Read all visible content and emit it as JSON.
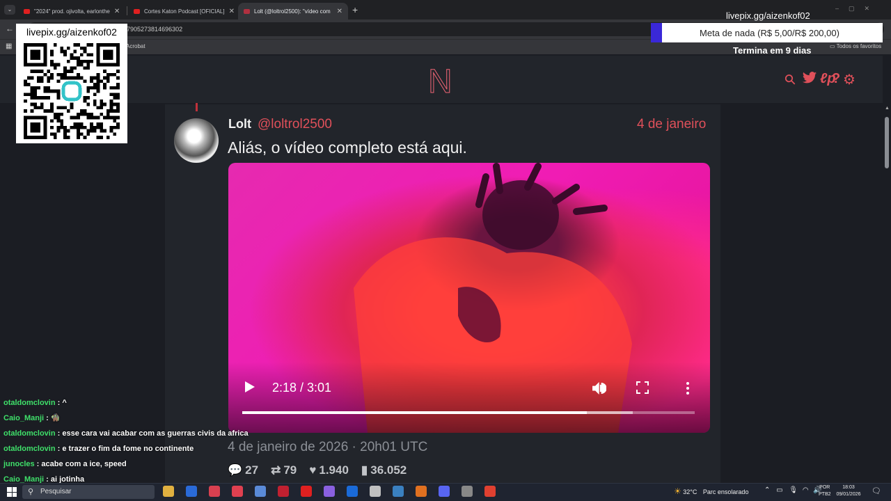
{
  "browser": {
    "tabs": [
      {
        "title": "\"2024\" prod. ojivolta, earlonthe",
        "favicon_color": "#e02020"
      },
      {
        "title": "Cortes Katon Podcast [OFICIAL]",
        "favicon_color": "#e02020"
      },
      {
        "title": "Lolt (@loltrol2500): \"vídeo com",
        "favicon_color": "#b03040"
      }
    ],
    "new_tab": "+",
    "url_fragment": "s/2007905273814696302",
    "bookmark_acrobat": "Acrobat",
    "bookmark_all": "Todos os favoritos"
  },
  "site": {
    "logo": "N",
    "accent": "#e0505a",
    "icons": [
      "search-icon",
      "twitter-icon",
      "lp-icon",
      "help-icon",
      "gear-icon"
    ],
    "icon_glyphs": {
      "search": "⚲",
      "twitter": "🐦",
      "lp": "ℓp",
      "help": "?",
      "gear": "⚙"
    }
  },
  "post": {
    "author": "Lolt",
    "handle": "@loltrol2500",
    "date": "4 de janeiro",
    "text": "Aliás, o vídeo completo está aqui.",
    "timestamp": "4 de janeiro de 2026 · 20h01 UTC",
    "video": {
      "time": "2:18 / 3:01",
      "progress": 0.762,
      "buffered": 0.863
    },
    "stats": {
      "replies": "27",
      "reposts": "79",
      "likes": "1.940",
      "views": "36.052"
    }
  },
  "overlay": {
    "qr_label": "livepix.gg/aizenkof02",
    "top_label": "livepix.gg/aizenkof02",
    "goal_text": "Meta de nada (R$ 5,00/R$ 200,00)",
    "goal_progress": 0.025,
    "goal_color": "#3a28d8",
    "goal_sub": "Termina em 9 dias"
  },
  "chat": [
    {
      "user": "otaldomclovin",
      "message": "^"
    },
    {
      "user": "Caio_Manji",
      "message": "🧌"
    },
    {
      "user": "otaldomclovin",
      "message": "esse cara vai acabar com as guerras civis da africa"
    },
    {
      "user": "otaldomclovin",
      "message": "e trazer o fim da fome no continente"
    },
    {
      "user": "junocles",
      "message": "acabe com a ice, speed"
    },
    {
      "user": "Caio_Manji",
      "message": "ai jotinha"
    }
  ],
  "taskbar": {
    "search": "Pesquisar",
    "weather_temp": "32°C",
    "weather_desc": "Parc ensolarado",
    "lang_1": "POR",
    "lang_2": "PTB2",
    "time": "18:03",
    "date": "09/01/2026",
    "app_colors": [
      "#e0b040",
      "#2a6ad8",
      "#d84050",
      "#e04050",
      "#5a8ad8",
      "#c02030",
      "#e02020",
      "#8a60e0",
      "#1a6ad8",
      "#c0c0c0",
      "#3a80c0",
      "#e07020",
      "#5865f2",
      "#888888",
      "#e04030"
    ]
  }
}
